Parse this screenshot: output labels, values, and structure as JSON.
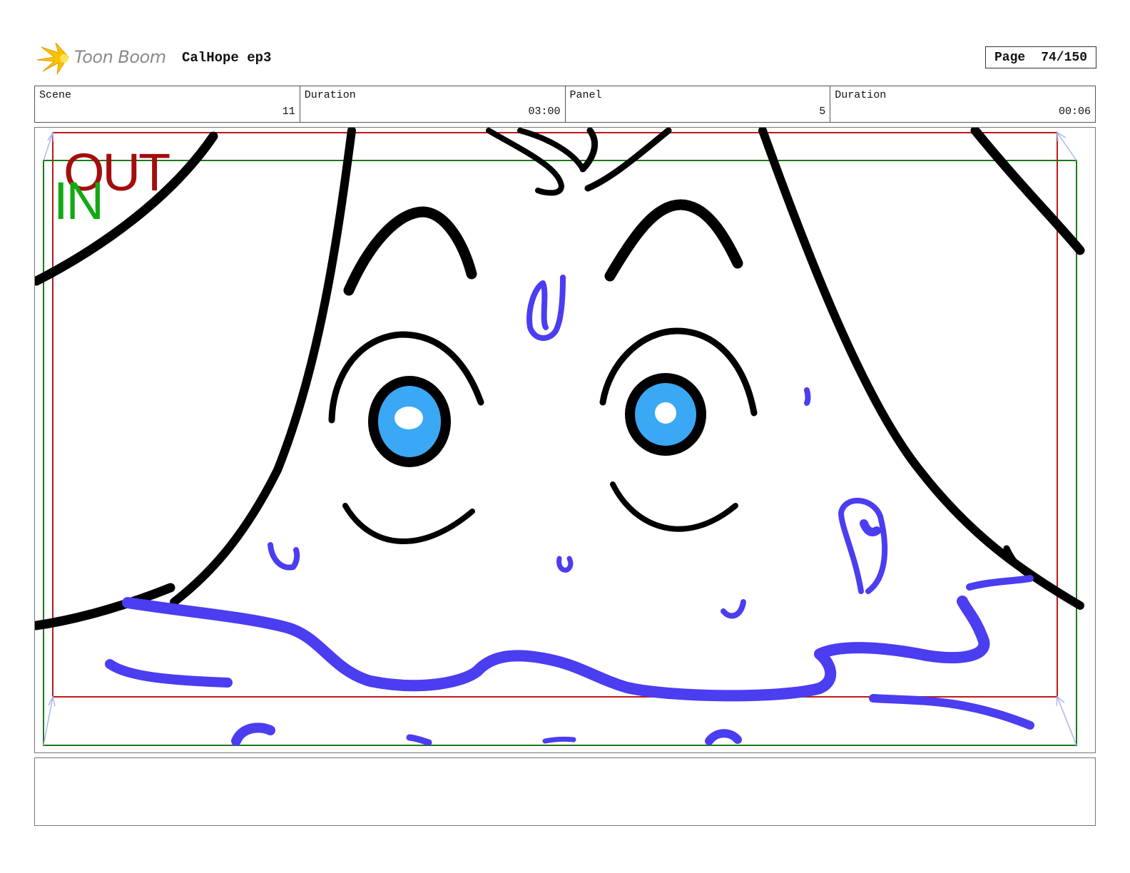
{
  "header": {
    "logo_text": "Toon Boom",
    "project_title": "CalHope ep3",
    "page_label": "Page",
    "page_value": "74/150"
  },
  "info": [
    {
      "label": "Scene",
      "value": "11"
    },
    {
      "label": "Duration",
      "value": "03:00"
    },
    {
      "label": "Panel",
      "value": "5"
    },
    {
      "label": "Duration",
      "value": "00:06"
    }
  ],
  "panel": {
    "out_label": "OUT",
    "in_label": "IN",
    "colors": {
      "out_frame": "#c01818",
      "in_frame": "#1a7a1a",
      "ink": "#000000",
      "sweat": "#4b3df0",
      "iris": "#3aa8f5"
    }
  },
  "notes": {
    "text": ""
  }
}
